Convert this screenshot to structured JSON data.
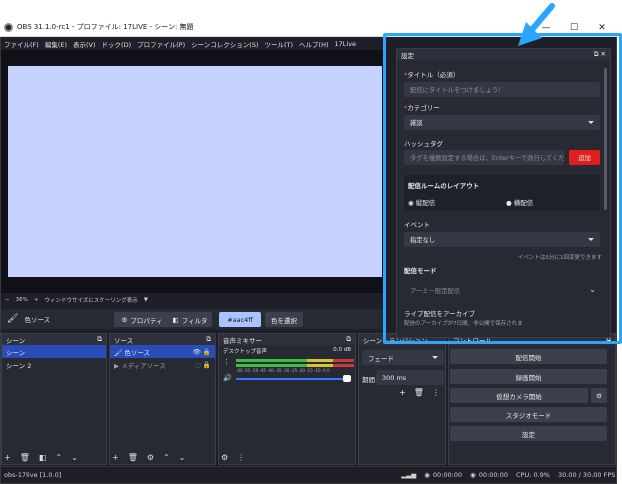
{
  "window": {
    "title": "OBS 31.1.0-rc1 - プロファイル: 17LIVE - シーン: 無題",
    "minimize": "—",
    "maximize": "☐",
    "close": "✕"
  },
  "menu": [
    "ファイル(F)",
    "編集(E)",
    "表示(V)",
    "ドック(D)",
    "プロファイル(P)",
    "シーンコレクション(S)",
    "ツール(T)",
    "ヘルプ(H)",
    "17Live"
  ],
  "zoom": {
    "value": "36%",
    "label": "ウィンドウサイズにスケーリング表示"
  },
  "source_toolbar": {
    "source_name": "色ソース",
    "properties": "プロパティ",
    "filters": "フィルタ",
    "color_value": "#aac4ff",
    "pick_color": "色を選択"
  },
  "scenes": {
    "title": "シーン",
    "items": [
      "シーン",
      "シーン 2"
    ]
  },
  "sources": {
    "title": "ソース",
    "items": [
      "色ソース",
      "メディアソース"
    ]
  },
  "mixer": {
    "title": "音声ミキサー",
    "channel": "デスクトップ音声",
    "db": "0.0 dB",
    "scale": "-60 -55 -50 -45 -40 -35 -30 -25 -20 -15 -10 -5 0"
  },
  "transitions": {
    "title": "シーントランジション",
    "type": "フェード",
    "duration_label": "期間",
    "duration": "300 ms"
  },
  "controls": {
    "title": "コントロール",
    "buttons": [
      "配信開始",
      "録画開始",
      "仮想カメラ開始",
      "スタジオモード",
      "設定"
    ]
  },
  "settings": {
    "title": "設定",
    "title_label": "タイトル（必須）",
    "title_placeholder": "配信にタイトルをつけましょう！",
    "category_label": "カテゴリー",
    "category_value": "雑談",
    "hashtag_label": "ハッシュタグ",
    "hashtag_placeholder": "タグを複数設定する場合は、Enterキーで改行してくだ...",
    "add_button": "追加",
    "layout_label": "配信ルームのレイアウト",
    "layout_vertical": "縦配信",
    "layout_horizontal": "横配信",
    "event_label": "イベント",
    "event_value": "指定なし",
    "event_note": "イベントは5分に1回変更できます",
    "mode_label": "配信モード",
    "mode_value": "アーミー限定配信",
    "archive_label": "ライブ配信をアーカイブ",
    "archive_note": "配信のアーカイブが7日間、非公開で保存されま"
  },
  "status": {
    "version": "obs-17live [1.0.0]",
    "rec_time": "00:00:00",
    "stream_time": "00:00:00",
    "cpu": "CPU: 0.9%",
    "fps": "30.00 / 30.00 FPS"
  },
  "colors": {
    "accent": "#2ba6ff",
    "add_button": "#e01e1e",
    "preview": "#c6d2ff",
    "selection": "#284cb8"
  }
}
